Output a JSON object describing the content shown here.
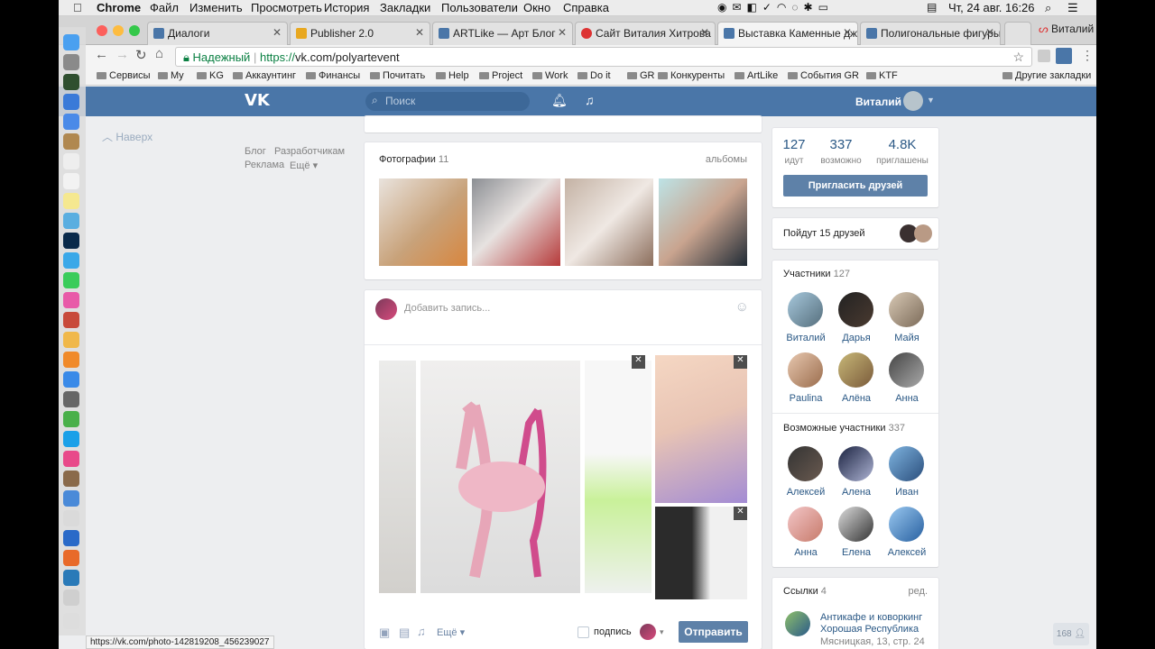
{
  "menubar": {
    "app": "Chrome",
    "items": [
      "Файл",
      "Изменить",
      "Просмотреть",
      "История",
      "Закладки",
      "Пользователи",
      "Окно",
      "Справка"
    ],
    "clock": "Чт, 24 авг.  16:26",
    "user": "Виталий"
  },
  "tabs": [
    {
      "label": "Диалоги"
    },
    {
      "label": "Publisher 2.0"
    },
    {
      "label": "ARTLike — Арт Блог"
    },
    {
      "label": "Сайт Виталия Хитрова"
    },
    {
      "label": "Выставка Каменные джу"
    },
    {
      "label": "Полигональные фигуры"
    }
  ],
  "address": {
    "secure": "Надежный",
    "url_scheme": "https://",
    "url_host": "vk.com/polyartevent"
  },
  "bookmarks": [
    "Сервисы",
    "My",
    "KG",
    "Аккаунтинг",
    "Финансы",
    "Почитать",
    "Help",
    "Project",
    "Work",
    "Do it",
    "GR",
    "Конкуренты",
    "ArtLike",
    "События GR",
    "KTF",
    "Другие закладки"
  ],
  "vk": {
    "search_placeholder": "Поиск",
    "user_name": "Виталий",
    "sidebar": {
      "up": "Наверх",
      "links": [
        "Блог",
        "Разработчикам",
        "Реклама",
        "Ещё"
      ]
    },
    "photos": {
      "title": "Фотографии",
      "count": "11",
      "albums": "альбомы"
    },
    "post": {
      "placeholder": "Добавить запись...",
      "more": "Ещё",
      "signature": "подпись",
      "send": "Отправить"
    },
    "stats": [
      {
        "num": "127",
        "label": "идут"
      },
      {
        "num": "337",
        "label": "возможно"
      },
      {
        "num": "4.8K",
        "label": "приглашены"
      }
    ],
    "invite": "Пригласить друзей",
    "friends_going": "Пойдут 15 друзей",
    "members": {
      "title": "Участники",
      "count": "127",
      "names": [
        "Виталий",
        "Дарья",
        "Майя",
        "Paulina",
        "Алёна",
        "Анна"
      ]
    },
    "possible": {
      "title": "Возможные участники",
      "count": "337",
      "names": [
        "Алексей",
        "Алена",
        "Иван",
        "Анна",
        "Елена",
        "Алексей"
      ]
    },
    "links": {
      "title": "Ссылки",
      "count": "4",
      "edit": "ред.",
      "name1": "Антикафе и коворкинг",
      "name2": "Хорошая Республика",
      "addr": "Мясницкая, 13, стр. 24"
    },
    "chat_count": "168"
  },
  "status_url": "https://vk.com/photo-142819208_456239027"
}
